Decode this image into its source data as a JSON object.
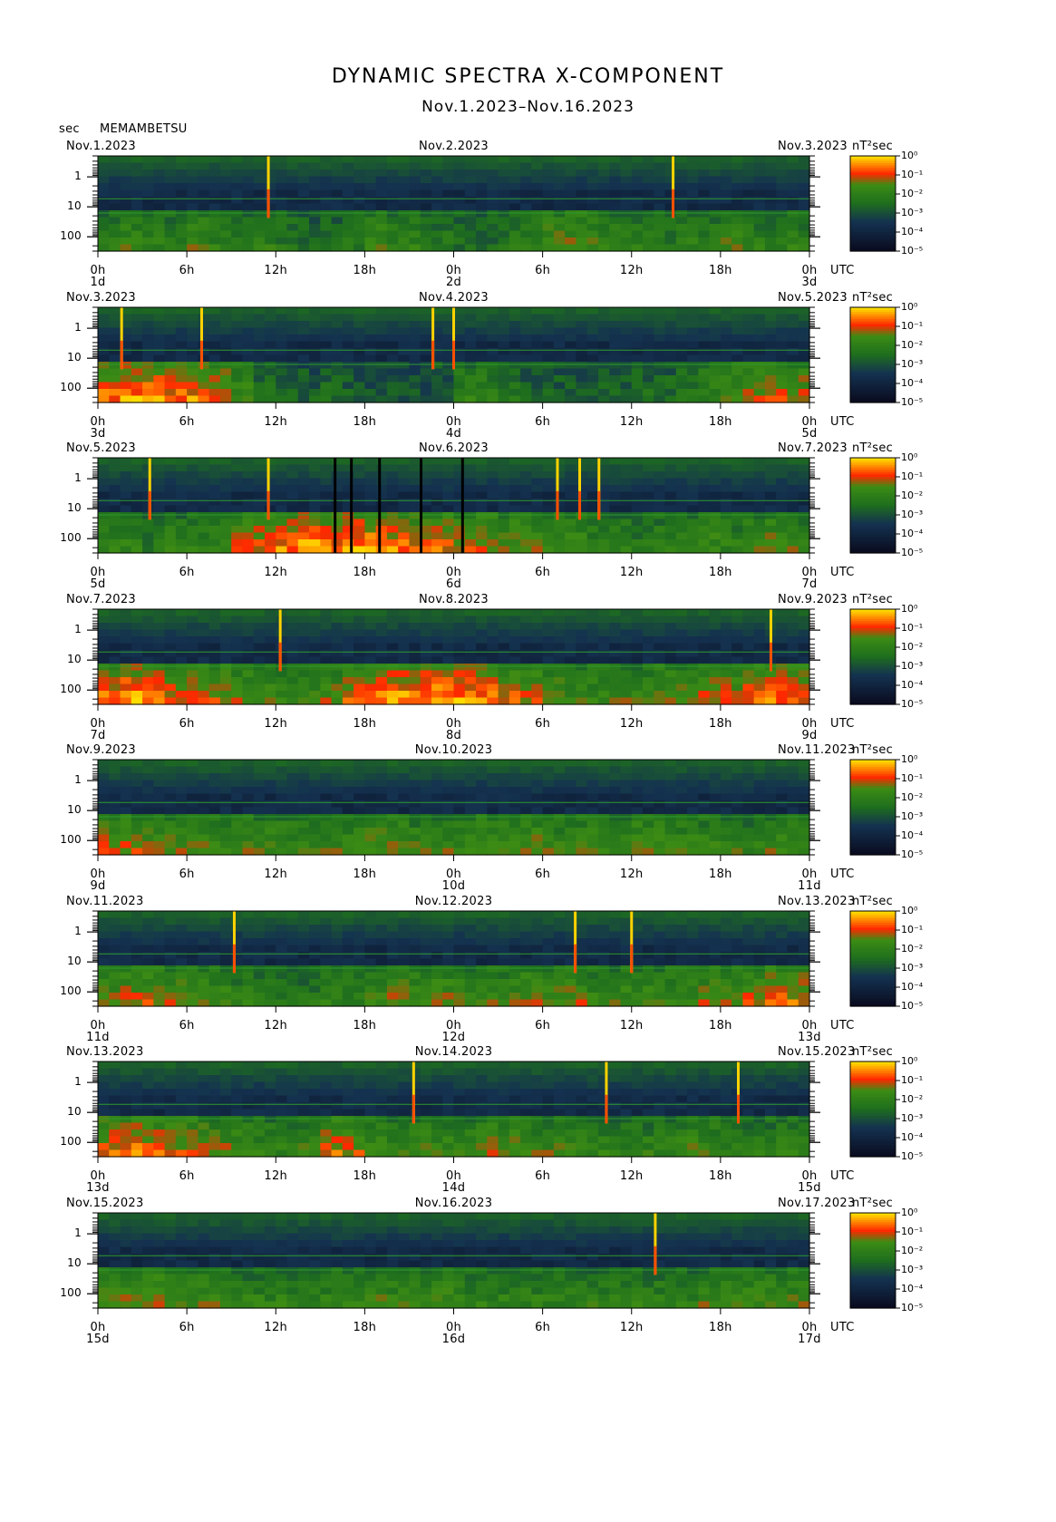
{
  "title": "DYNAMIC SPECTRA X-COMPONENT",
  "subtitle": "Nov.1.2023–Nov.16.2023",
  "y_unit": "sec",
  "station": "MEMAMBETSU",
  "colorbar_unit": "nT²sec",
  "utc_label": "UTC",
  "colors": {
    "low": "#0a0a1e",
    "mid": "#1e7a1e",
    "high": "#ff2a00",
    "peak": "#ffd800"
  },
  "chart_data": {
    "type": "heatmap",
    "description_scale": "log",
    "y_axis": {
      "label": "sec",
      "ticks": [
        "1",
        "10",
        "100"
      ],
      "scale": "log",
      "range": [
        0.2,
        300
      ]
    },
    "x_ticks": [
      "0h",
      "6h",
      "12h",
      "18h",
      "0h",
      "6h",
      "12h",
      "18h",
      "0h"
    ],
    "colorbar_ticks": [
      "10⁰",
      "10⁻¹",
      "10⁻²",
      "10⁻³",
      "10⁻⁴",
      "10⁻⁵"
    ],
    "panels": [
      {
        "left_date": "Nov.1.2023",
        "mid_date": "Nov.2.2023",
        "right_date": "Nov.3.2023",
        "day_labels": [
          "1d",
          "2d",
          "3d"
        ],
        "spikes_hours": [
          11.5,
          38.8
        ],
        "gaps_hours": [],
        "activity": [
          0.3,
          0.35,
          0.3,
          0.3,
          0.35,
          0.3,
          0.3,
          0.3,
          0.25,
          0.2,
          0.2,
          0.25,
          0.35,
          0.3,
          0.3,
          0.25,
          0.2,
          0.2,
          0.25,
          0.3,
          0.4,
          0.4,
          0.35,
          0.3,
          0.3,
          0.25,
          0.3,
          0.3,
          0.35,
          0.3,
          0.3,
          0.3
        ]
      },
      {
        "left_date": "Nov.3.2023",
        "mid_date": "Nov.4.2023",
        "right_date": "Nov.5.2023",
        "day_labels": [
          "3d",
          "4d",
          "5d"
        ],
        "spikes_hours": [
          1.6,
          7.0,
          22.6,
          24.0
        ],
        "gaps_hours": [],
        "activity": [
          0.55,
          0.6,
          0.6,
          0.55,
          0.55,
          0.5,
          0.35,
          0.2,
          0.15,
          0.15,
          0.2,
          0.15,
          0.1,
          0.1,
          0.1,
          0.15,
          0.3,
          0.3,
          0.25,
          0.15,
          0.15,
          0.15,
          0.15,
          0.15,
          0.2,
          0.2,
          0.25,
          0.3,
          0.4,
          0.45,
          0.45,
          0.45
        ]
      },
      {
        "left_date": "Nov.5.2023",
        "mid_date": "Nov.6.2023",
        "right_date": "Nov.7.2023",
        "day_labels": [
          "5d",
          "6d",
          "7d"
        ],
        "spikes_hours": [
          3.5,
          11.5,
          31.0,
          32.5,
          33.8
        ],
        "gaps_hours": [
          16.0,
          17.1,
          19.0,
          21.8,
          24.6
        ],
        "activity": [
          0.3,
          0.3,
          0.25,
          0.3,
          0.3,
          0.3,
          0.45,
          0.5,
          0.55,
          0.6,
          0.55,
          0.6,
          0.6,
          0.55,
          0.5,
          0.5,
          0.45,
          0.45,
          0.4,
          0.4,
          0.35,
          0.35,
          0.3,
          0.3,
          0.25,
          0.3,
          0.3,
          0.35,
          0.3,
          0.35,
          0.4,
          0.35
        ]
      },
      {
        "left_date": "Nov.7.2023",
        "mid_date": "Nov.8.2023",
        "right_date": "Nov.9.2023",
        "day_labels": [
          "7d",
          "8d",
          "9d"
        ],
        "spikes_hours": [
          12.3,
          45.4
        ],
        "gaps_hours": [],
        "activity": [
          0.55,
          0.6,
          0.55,
          0.5,
          0.5,
          0.45,
          0.4,
          0.35,
          0.3,
          0.35,
          0.4,
          0.5,
          0.55,
          0.6,
          0.6,
          0.6,
          0.6,
          0.55,
          0.5,
          0.45,
          0.4,
          0.35,
          0.35,
          0.35,
          0.35,
          0.4,
          0.4,
          0.45,
          0.45,
          0.5,
          0.55,
          0.5
        ]
      },
      {
        "left_date": "Nov.9.2023",
        "mid_date": "Nov.10.2023",
        "right_date": "Nov.11.2023",
        "day_labels": [
          "9d",
          "10d",
          "11d"
        ],
        "spikes_hours": [],
        "gaps_hours": [],
        "activity": [
          0.45,
          0.45,
          0.4,
          0.4,
          0.4,
          0.35,
          0.35,
          0.35,
          0.35,
          0.35,
          0.35,
          0.35,
          0.4,
          0.4,
          0.35,
          0.35,
          0.35,
          0.4,
          0.4,
          0.4,
          0.35,
          0.35,
          0.35,
          0.35,
          0.4,
          0.4,
          0.35,
          0.35,
          0.35,
          0.3,
          0.35,
          0.35
        ]
      },
      {
        "left_date": "Nov.11.2023",
        "mid_date": "Nov.12.2023",
        "right_date": "Nov.13.2023",
        "day_labels": [
          "11d",
          "12d",
          "13d"
        ],
        "spikes_hours": [
          9.2,
          32.2,
          36.0
        ],
        "gaps_hours": [],
        "activity": [
          0.4,
          0.45,
          0.45,
          0.4,
          0.35,
          0.35,
          0.3,
          0.3,
          0.25,
          0.25,
          0.3,
          0.3,
          0.35,
          0.4,
          0.4,
          0.4,
          0.35,
          0.35,
          0.35,
          0.4,
          0.4,
          0.4,
          0.35,
          0.35,
          0.35,
          0.35,
          0.35,
          0.4,
          0.4,
          0.45,
          0.5,
          0.5
        ]
      },
      {
        "left_date": "Nov.13.2023",
        "mid_date": "Nov.14.2023",
        "right_date": "Nov.15.2023",
        "day_labels": [
          "13d",
          "14d",
          "15d"
        ],
        "spikes_hours": [
          21.3,
          34.3,
          43.2
        ],
        "gaps_hours": [],
        "activity": [
          0.5,
          0.55,
          0.5,
          0.45,
          0.45,
          0.4,
          0.35,
          0.3,
          0.3,
          0.35,
          0.5,
          0.45,
          0.35,
          0.35,
          0.35,
          0.35,
          0.35,
          0.4,
          0.4,
          0.35,
          0.35,
          0.35,
          0.3,
          0.3,
          0.3,
          0.3,
          0.35,
          0.35,
          0.3,
          0.3,
          0.3,
          0.3
        ]
      },
      {
        "left_date": "Nov.15.2023",
        "mid_date": "Nov.16.2023",
        "right_date": "Nov.17.2023",
        "day_labels": [
          "15d",
          "16d",
          "17d"
        ],
        "spikes_hours": [
          37.6
        ],
        "gaps_hours": [],
        "activity": [
          0.4,
          0.4,
          0.45,
          0.4,
          0.35,
          0.35,
          0.3,
          0.3,
          0.3,
          0.3,
          0.3,
          0.35,
          0.35,
          0.35,
          0.35,
          0.35,
          0.3,
          0.3,
          0.3,
          0.3,
          0.3,
          0.3,
          0.3,
          0.3,
          0.3,
          0.3,
          0.3,
          0.35,
          0.35,
          0.35,
          0.35,
          0.35
        ]
      }
    ]
  }
}
